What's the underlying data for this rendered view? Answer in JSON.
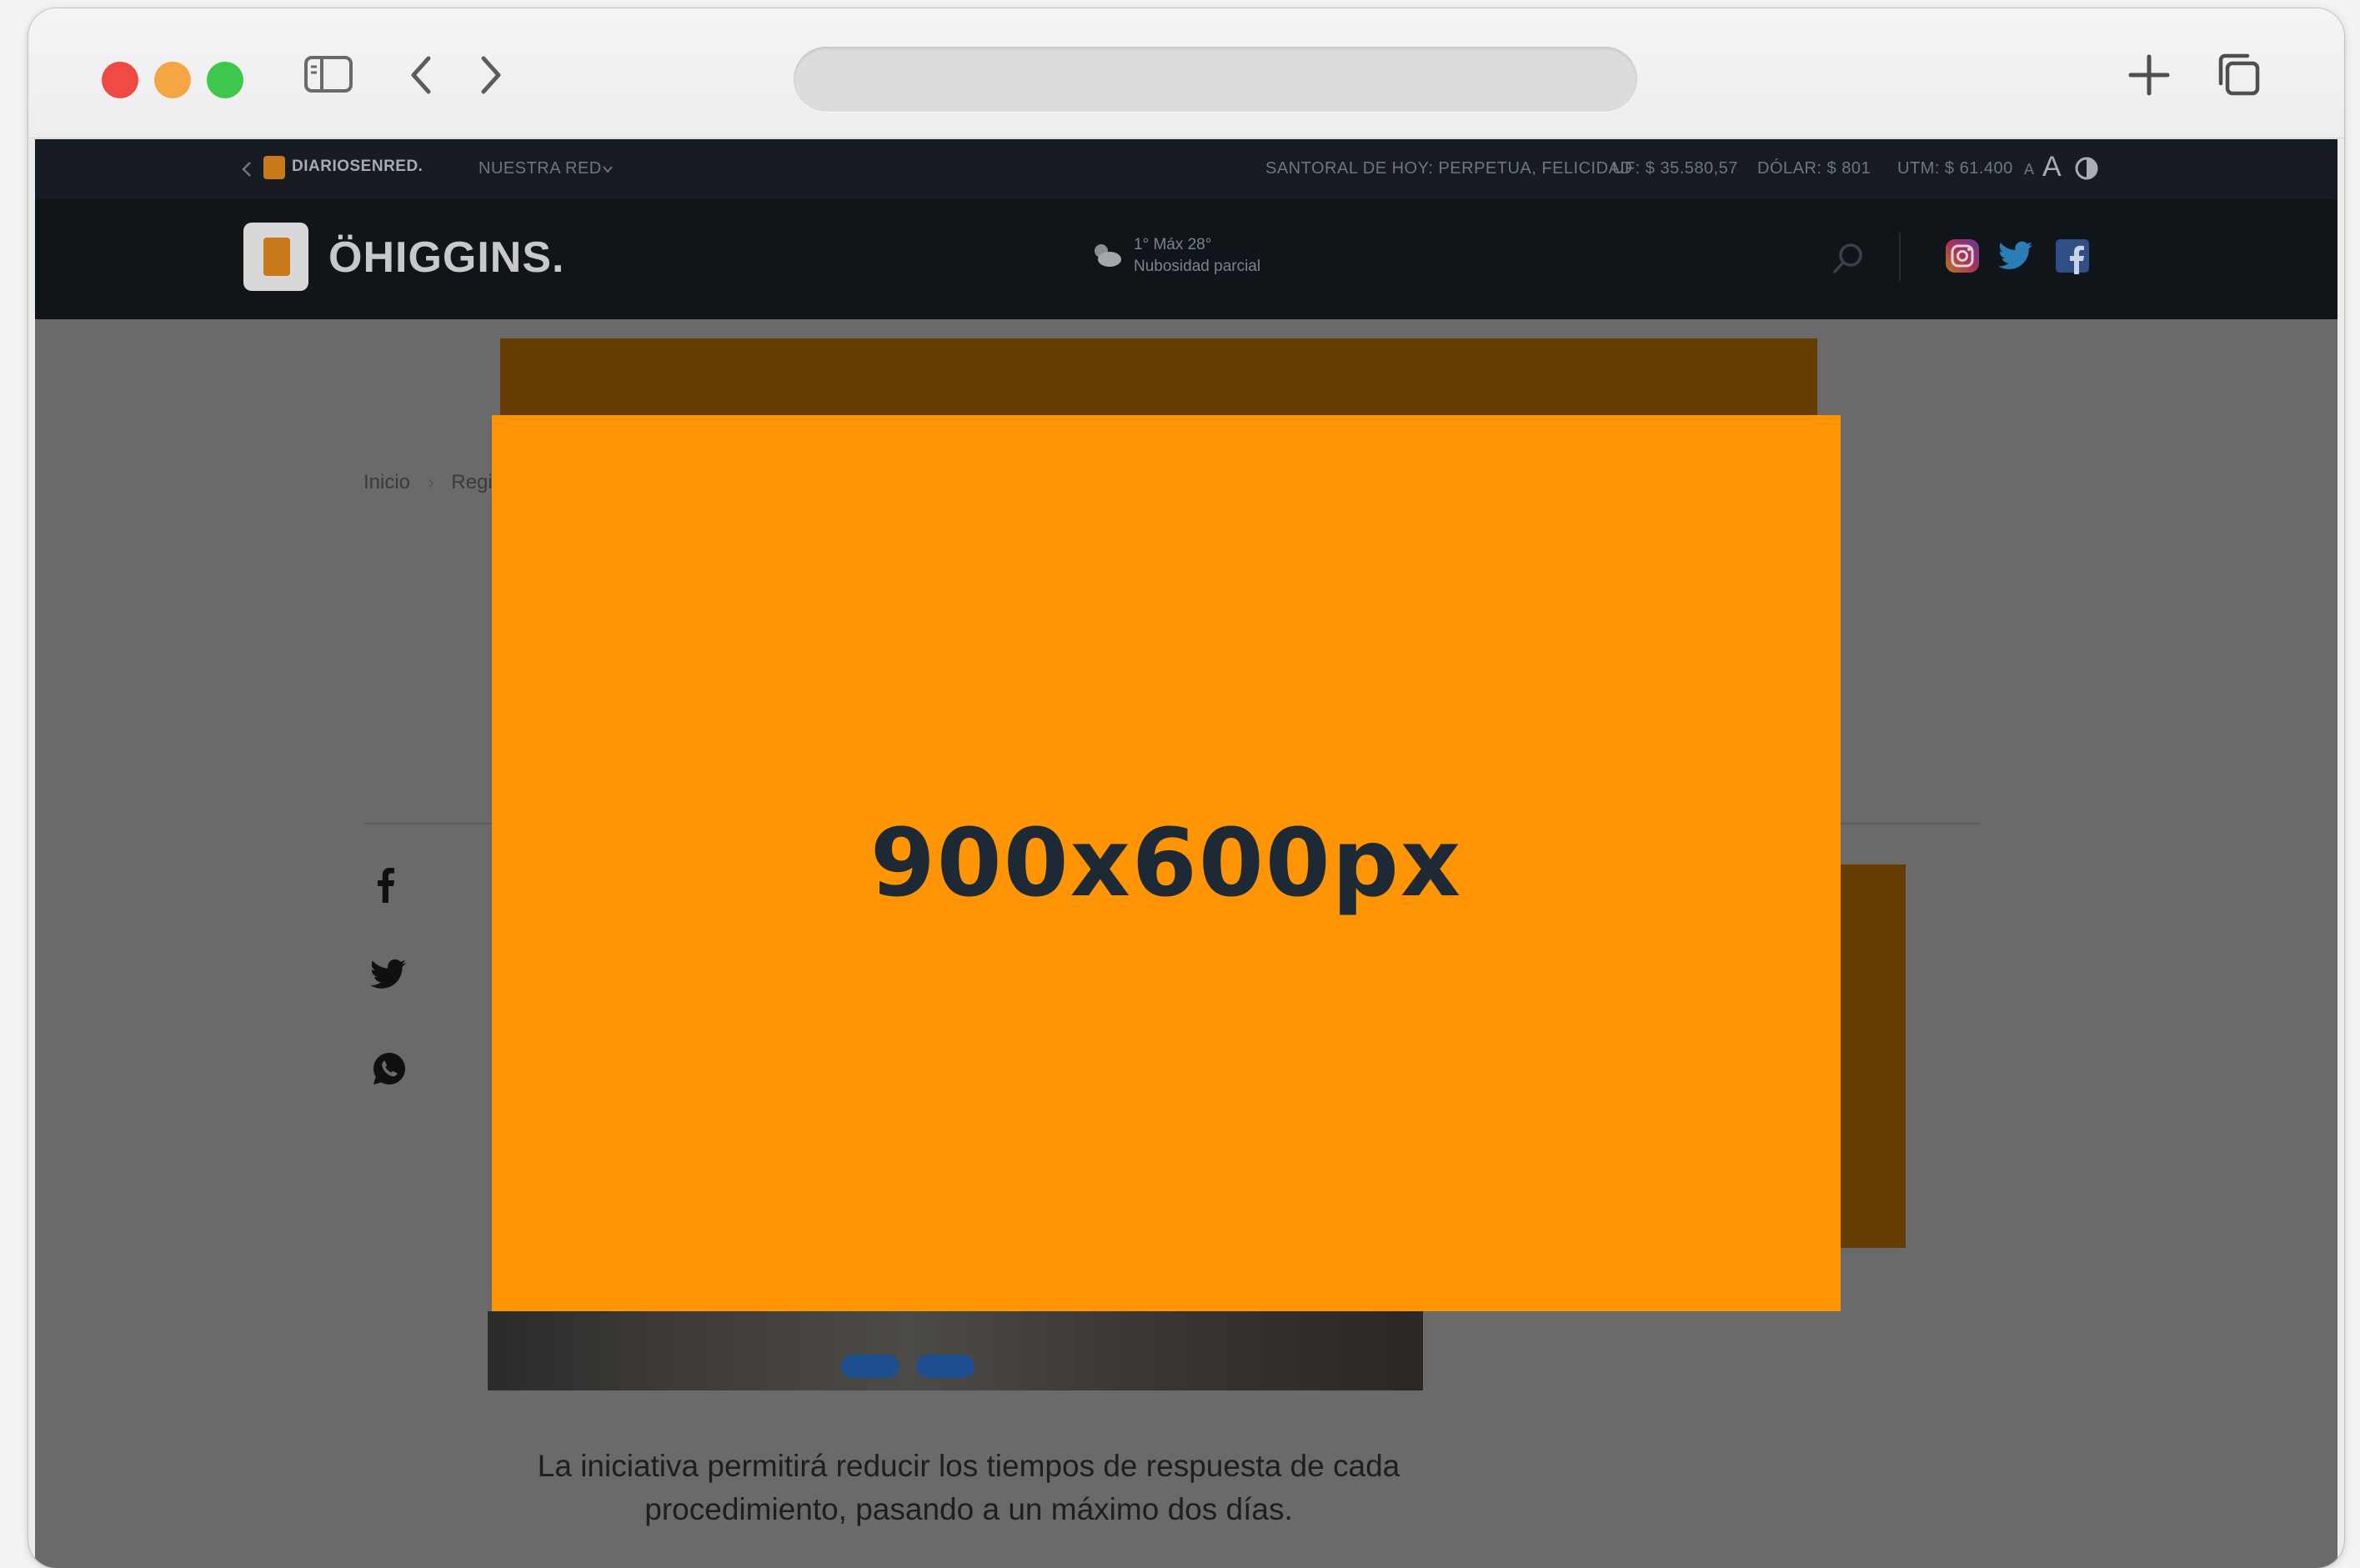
{
  "browser": {
    "address_value": "",
    "buttons": [
      "sidebar-toggle",
      "back",
      "forward",
      "new-tab",
      "tab-overview"
    ]
  },
  "topbar": {
    "network_logo": "DIARIOSENRED.",
    "network_menu": "NUESTRA RED",
    "santoral": "SANTORAL DE HOY: PERPETUA, FELICIDAD",
    "uf": "UF: $ 35.580,57",
    "dolar": "DÓLAR: $ 801",
    "utm": "UTM: $ 61.400",
    "font_small": "A",
    "font_large": "A"
  },
  "header": {
    "logo": "ÖHIGGINS.",
    "weather_temp": "1° Máx 28°",
    "weather_desc": "Nubosidad parcial"
  },
  "breadcrumb": {
    "home": "Inicio",
    "section": "Regi"
  },
  "share": [
    "facebook-icon",
    "twitter-icon",
    "whatsapp-icon"
  ],
  "caption": "La iniciativa permitirá reducir los tiempos de respuesta de cada procedimiento, pasando a un máximo dos días.",
  "ad": {
    "label": "900x600px",
    "background": "#ff9405",
    "text_color": "#1d2a36"
  },
  "colors": {
    "overlay_page": "#6a6a6a",
    "header_dark": "#10151a",
    "topbar_dark": "#171c22",
    "ad_orange": "#ff9405",
    "dim_orange": "#663d00"
  }
}
